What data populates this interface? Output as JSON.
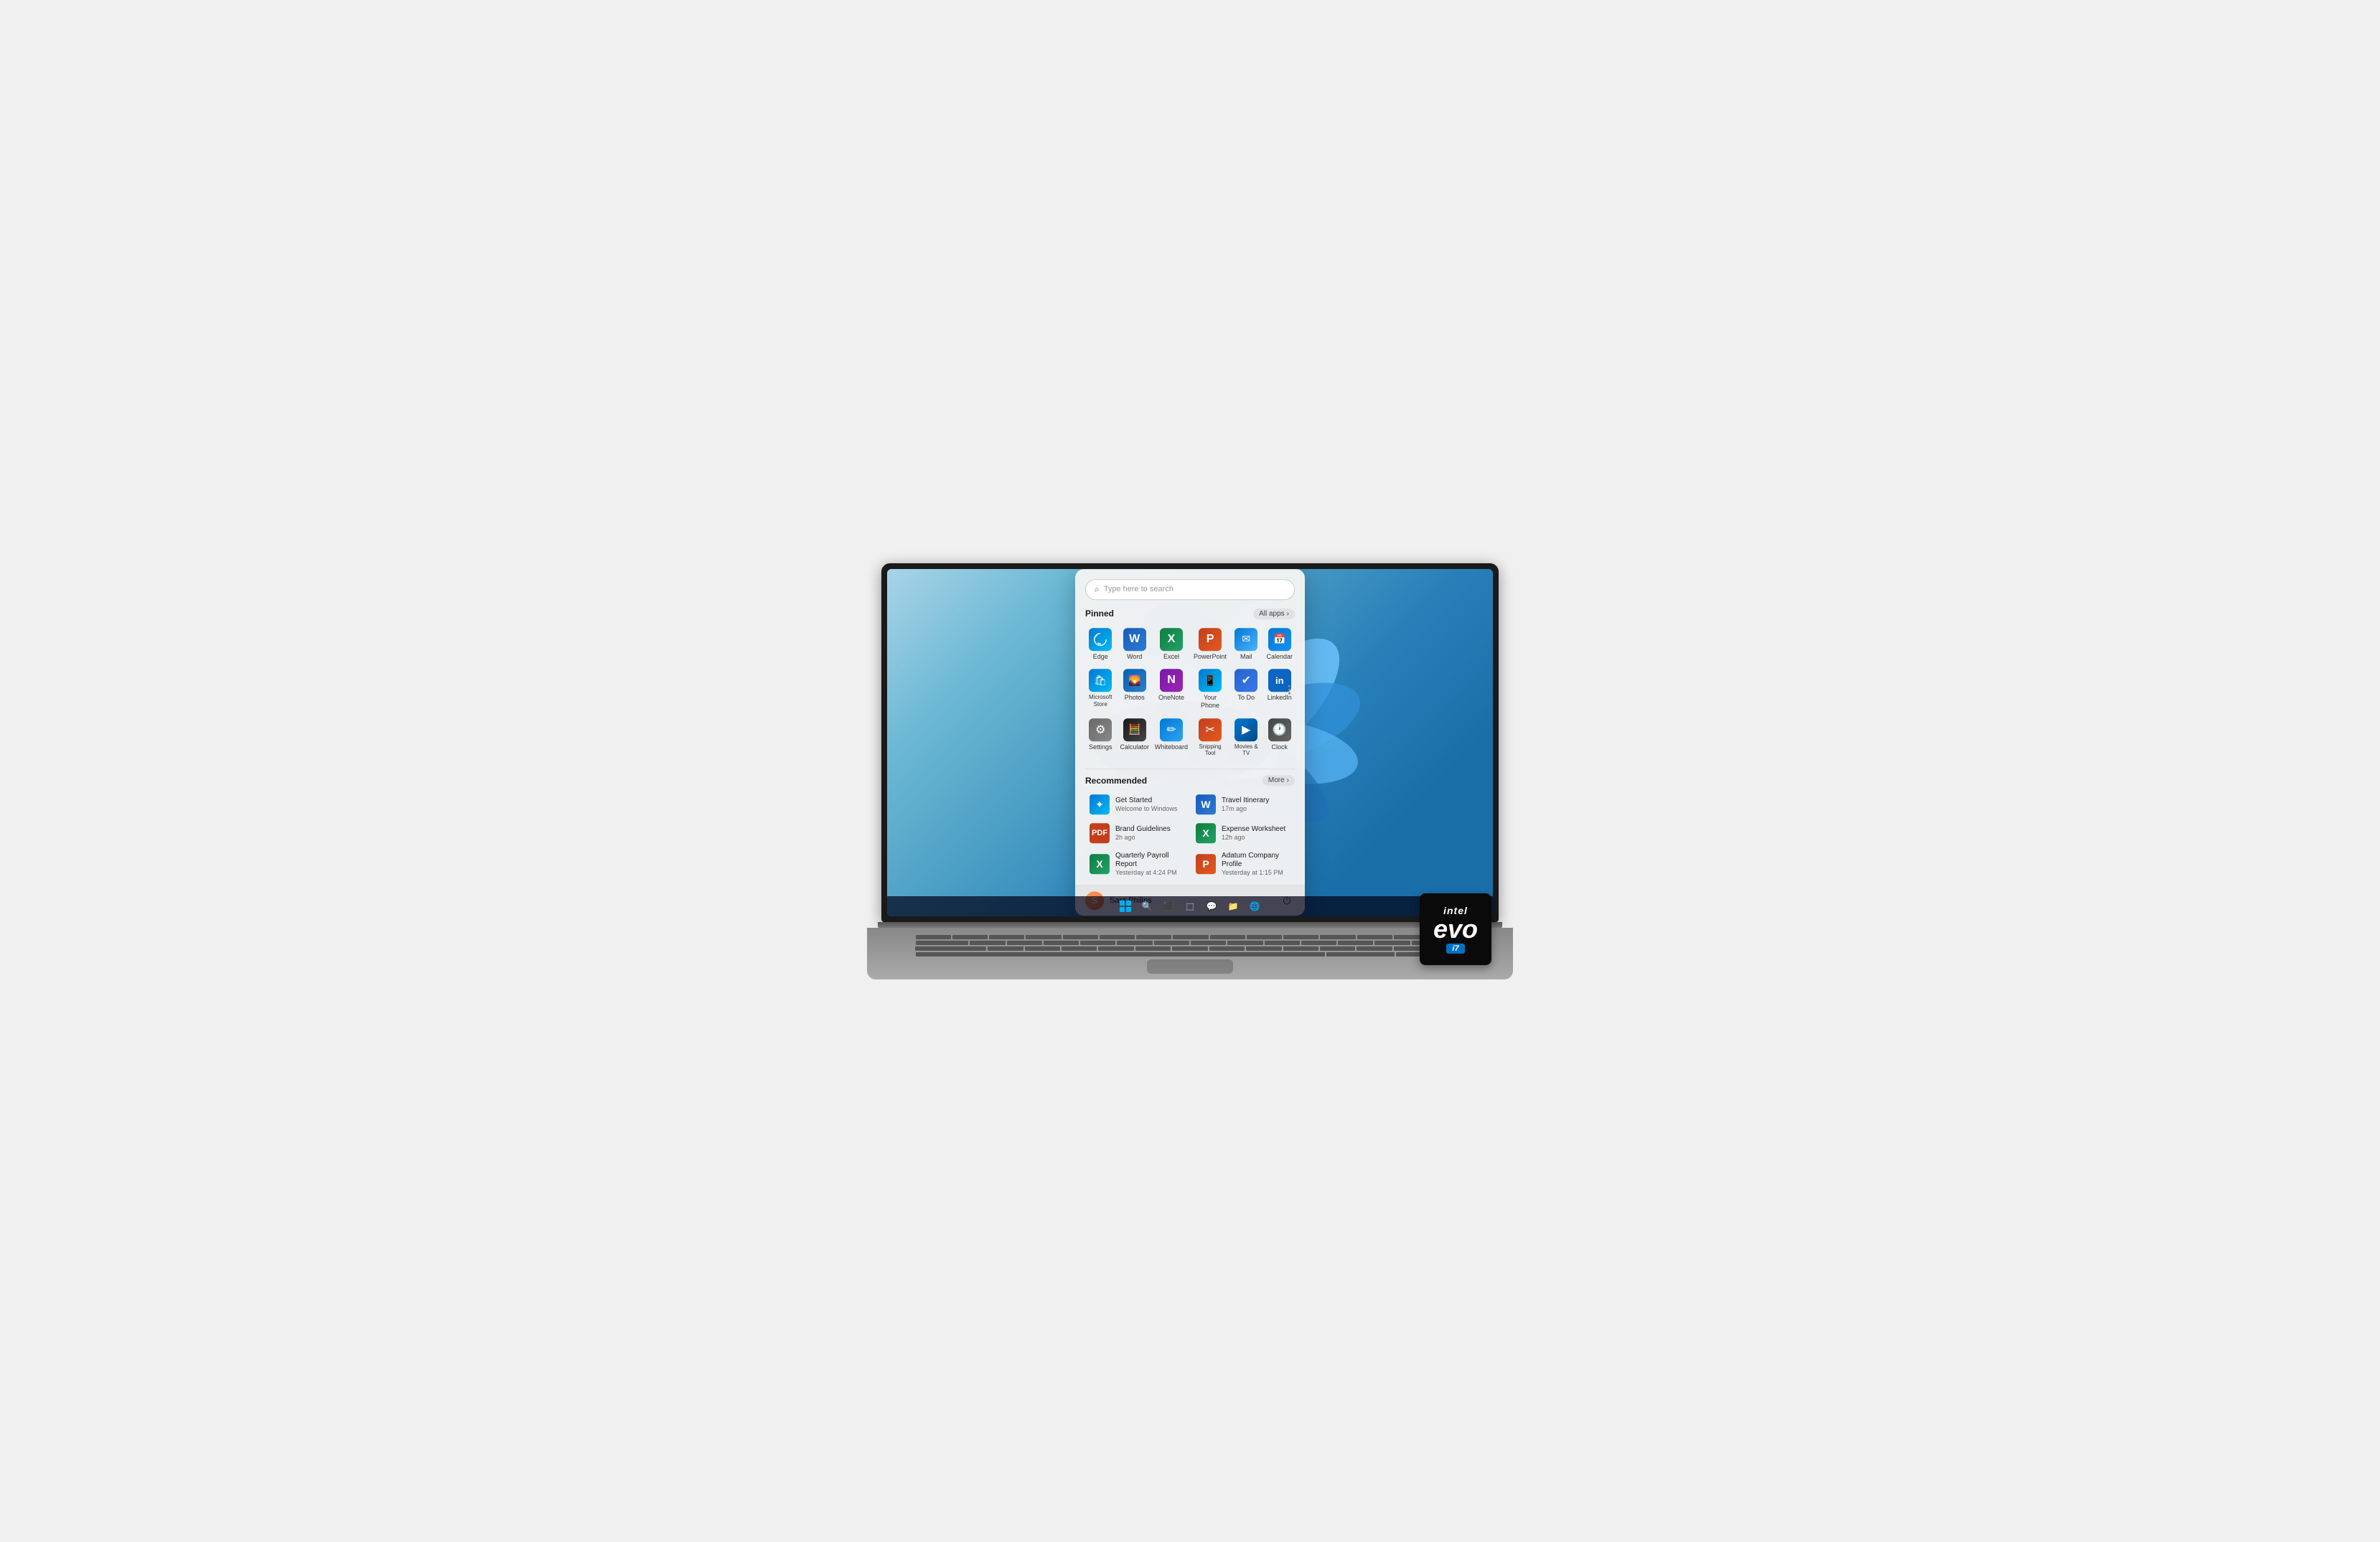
{
  "laptop": {
    "screen": {
      "background_gradient": "linear-gradient(135deg, #a8d4e8, #2980b9)"
    }
  },
  "start_menu": {
    "search": {
      "placeholder": "Type here to search"
    },
    "pinned": {
      "title": "Pinned",
      "all_apps_label": "All apps",
      "apps": [
        {
          "id": "edge",
          "label": "Edge",
          "icon_class": "icon-edge",
          "symbol": "e"
        },
        {
          "id": "word",
          "label": "Word",
          "icon_class": "icon-word",
          "symbol": "W"
        },
        {
          "id": "excel",
          "label": "Excel",
          "icon_class": "icon-excel",
          "symbol": "X"
        },
        {
          "id": "powerpoint",
          "label": "PowerPoint",
          "icon_class": "icon-ppt",
          "symbol": "P"
        },
        {
          "id": "mail",
          "label": "Mail",
          "icon_class": "icon-mail",
          "symbol": "✉"
        },
        {
          "id": "calendar",
          "label": "Calendar",
          "icon_class": "icon-calendar",
          "symbol": "📅"
        },
        {
          "id": "store",
          "label": "Microsoft Store",
          "icon_class": "icon-store",
          "symbol": "🏪"
        },
        {
          "id": "photos",
          "label": "Photos",
          "icon_class": "icon-photos",
          "symbol": "🌄"
        },
        {
          "id": "onenote",
          "label": "OneNote",
          "icon_class": "icon-onenote",
          "symbol": "N"
        },
        {
          "id": "yourphone",
          "label": "Your Phone",
          "icon_class": "icon-yourphone",
          "symbol": "📱"
        },
        {
          "id": "todo",
          "label": "To Do",
          "icon_class": "icon-todo",
          "symbol": "✔"
        },
        {
          "id": "linkedin",
          "label": "LinkedIn",
          "icon_class": "icon-linkedin",
          "symbol": "in"
        },
        {
          "id": "settings",
          "label": "Settings",
          "icon_class": "icon-settings",
          "symbol": "⚙"
        },
        {
          "id": "calculator",
          "label": "Calculator",
          "icon_class": "icon-calculator",
          "symbol": "🧮"
        },
        {
          "id": "whiteboard",
          "label": "Whiteboard",
          "icon_class": "icon-whiteboard",
          "symbol": "✏"
        },
        {
          "id": "snipping",
          "label": "Snipping Tool",
          "icon_class": "icon-snipping",
          "symbol": "✂"
        },
        {
          "id": "movies",
          "label": "Movies & TV",
          "icon_class": "icon-movies",
          "symbol": "▶"
        },
        {
          "id": "clock",
          "label": "Clock",
          "icon_class": "icon-clock",
          "symbol": "🕐"
        }
      ]
    },
    "recommended": {
      "title": "Recommended",
      "more_label": "More",
      "items": [
        {
          "id": "get-started",
          "name": "Get Started",
          "subtitle": "Welcome to Windows",
          "icon_class": "icon-store",
          "symbol": "✦"
        },
        {
          "id": "travel",
          "name": "Travel Itinerary",
          "subtitle": "17m ago",
          "icon_class": "icon-word",
          "symbol": "W"
        },
        {
          "id": "brand",
          "name": "Brand Guidelines",
          "subtitle": "2h ago",
          "icon_class": "icon-pdf",
          "symbol": "📄"
        },
        {
          "id": "expense",
          "name": "Expense Worksheet",
          "subtitle": "12h ago",
          "icon_class": "icon-excel",
          "symbol": "X"
        },
        {
          "id": "payroll",
          "name": "Quarterly Payroll Report",
          "subtitle": "Yesterday at 4:24 PM",
          "icon_class": "icon-excel",
          "symbol": "X"
        },
        {
          "id": "adatum",
          "name": "Adatum Company Profile",
          "subtitle": "Yesterday at 1:15 PM",
          "icon_class": "icon-ppt",
          "symbol": "P"
        }
      ]
    },
    "footer": {
      "user_name": "Sara Philips",
      "user_initial": "S"
    }
  },
  "taskbar": {
    "icons": [
      "⊞",
      "🔍",
      "⬛",
      "⬚",
      "💬",
      "📁",
      "e"
    ]
  },
  "intel_badge": {
    "brand": "intel",
    "product": "evo",
    "tier": "i7"
  }
}
